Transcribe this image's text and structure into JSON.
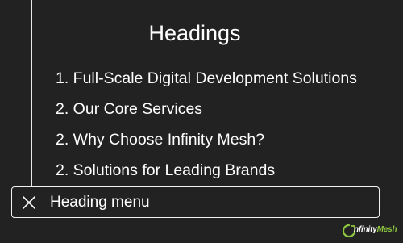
{
  "title": "Headings",
  "headings": [
    "1. Full-Scale Digital Development Solutions",
    "2. Our Core Services",
    "2. Why Choose Infinity Mesh?",
    "2. Solutions for Leading Brands"
  ],
  "menu": {
    "label": "Heading menu",
    "close_icon": "close-icon"
  },
  "logo": {
    "text_a": "nfinity",
    "text_b": "Mesh",
    "icon": "infinity-mesh-logo-icon"
  },
  "colors": {
    "background": "#222222",
    "text": "#ffffff",
    "border": "#f2f2f2",
    "brand_green": "#8dc63f"
  }
}
